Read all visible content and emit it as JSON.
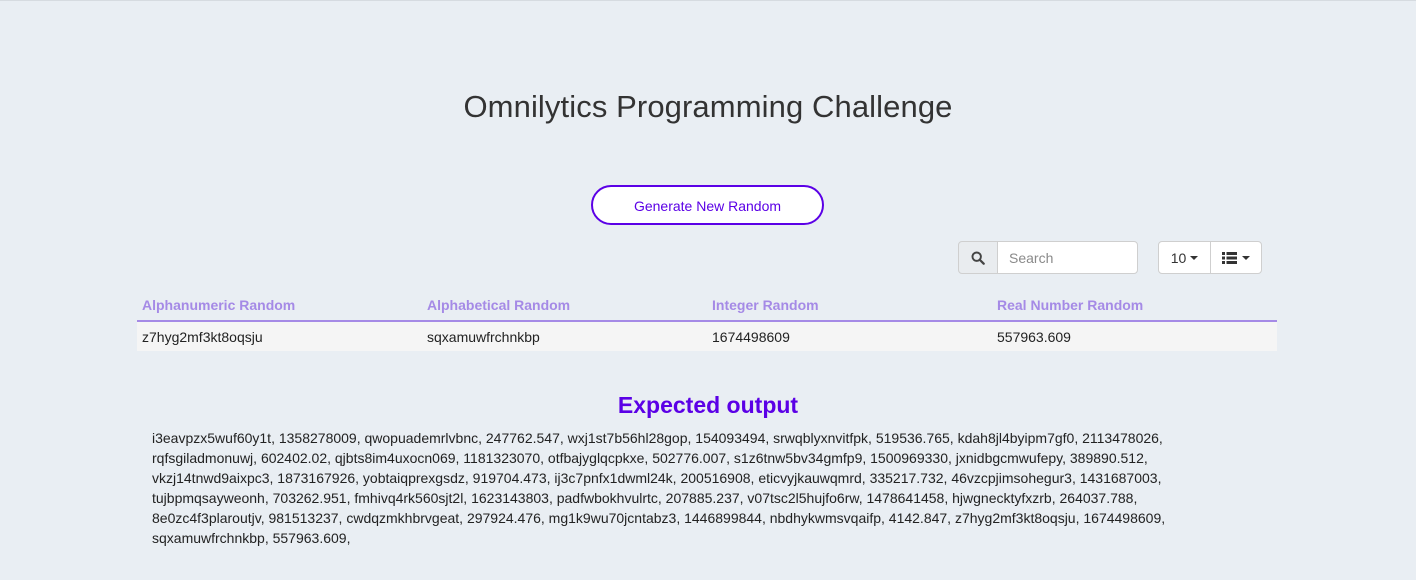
{
  "header": {
    "title": "Omnilytics Programming Challenge"
  },
  "actions": {
    "generate_label": "Generate New Random"
  },
  "toolbar": {
    "search_placeholder": "Search",
    "search_icon": "search-icon",
    "page_size": "10",
    "columns_icon": "list-icon"
  },
  "table": {
    "columns": [
      "Alphanumeric Random",
      "Alphabetical Random",
      "Integer Random",
      "Real Number Random"
    ],
    "rows": [
      [
        "z7hyg2mf3kt8oqsju",
        "sqxamuwfrchnkbp",
        "1674498609",
        "557963.609"
      ]
    ]
  },
  "expected": {
    "title": "Expected output",
    "lines": [
      "i3eavpzx5wuf60y1t, 1358278009, qwopuademrlvbnc, 247762.547, wxj1st7b56hl28gop, 154093494, srwqblyxnvitfpk, 519536.765, kdah8jl4byipm7gf0, 2113478026,",
      "rqfsgiladmonuwj, 602402.02, qjbts8im4uxocn069, 1181323070, otfbajyglqcpkxe, 502776.007, s1z6tnw5bv34gmfp9, 1500969330, jxnidbgcmwufepy, 389890.512,",
      "vkzj14tnwd9aixpc3, 1873167926, yobtaiqprexgsdz, 919704.473, ij3c7pnfx1dwml24k, 200516908, eticvyjkauwqmrd, 335217.732, 46vzcpjimsohegur3, 1431687003,",
      "tujbpmqsayweonh, 703262.951, fmhivq4rk560sjt2l, 1623143803, padfwbokhvulrtc, 207885.237, v07tsc2l5hujfo6rw, 1478641458, hjwgnecktyfxzrb, 264037.788,",
      "8e0zc4f3plaroutjv, 981513237, cwdqzmkhbrvgeat, 297924.476, mg1k9wu70jcntabz3, 1446899844, nbdhykwmsvqaifp, 4142.847, z7hyg2mf3kt8oqsju, 1674498609,",
      "sqxamuwfrchnkbp, 557963.609,"
    ]
  },
  "colors": {
    "accent": "#5b00e6",
    "header_text": "#a58ae6",
    "background": "#e9eef3"
  }
}
